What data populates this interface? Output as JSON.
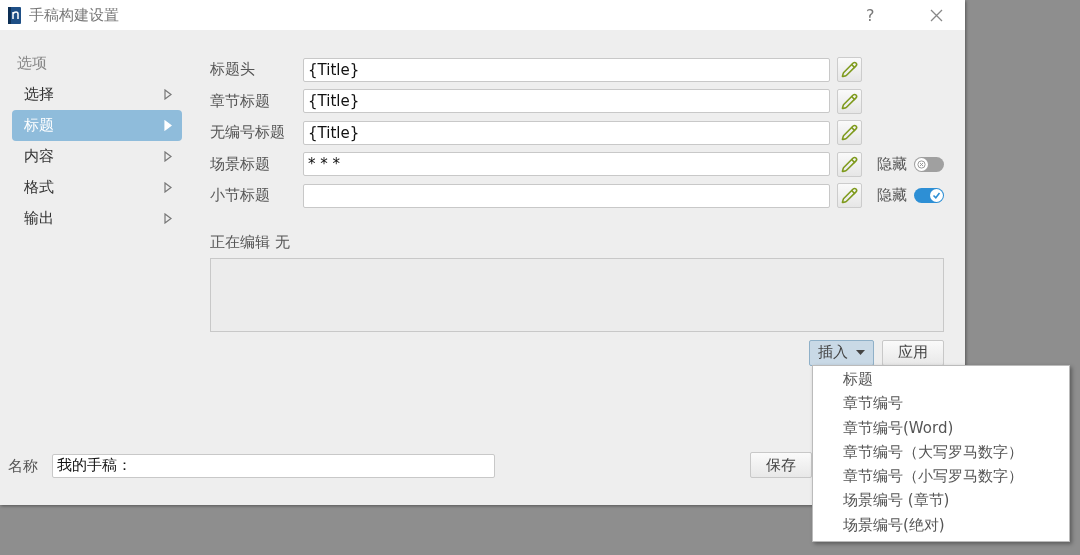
{
  "window": {
    "title": "手稿构建设置",
    "help": "?"
  },
  "sidebar": {
    "heading": "选项",
    "items": [
      {
        "label": "选择",
        "selected": false
      },
      {
        "label": "标题",
        "selected": true
      },
      {
        "label": "内容",
        "selected": false
      },
      {
        "label": "格式",
        "selected": false
      },
      {
        "label": "输出",
        "selected": false
      }
    ]
  },
  "title_rows": [
    {
      "label": "标题头",
      "value": "{Title}"
    },
    {
      "label": "章节标题",
      "value": "{Title}"
    },
    {
      "label": "无编号标题",
      "value": "{Title}"
    },
    {
      "label": "场景标题",
      "value": "* * *",
      "hide": {
        "label": "隐藏",
        "on": false
      }
    },
    {
      "label": "小节标题",
      "hide": {
        "label": "隐藏",
        "on": true
      }
    }
  ],
  "editing": {
    "label": "正在编辑 无"
  },
  "insert_button": {
    "label": "插入",
    "expanded": true
  },
  "apply_button": "应用",
  "insert_menu": [
    "标题",
    "章节编号",
    "章节编号(Word)",
    "章节编号（大写罗马数字）",
    "章节编号（小写罗马数字）",
    "场景编号 (章节)",
    "场景编号(绝对)"
  ],
  "name": {
    "label": "名称",
    "value": "我的手稿："
  },
  "save_button": "保存"
}
